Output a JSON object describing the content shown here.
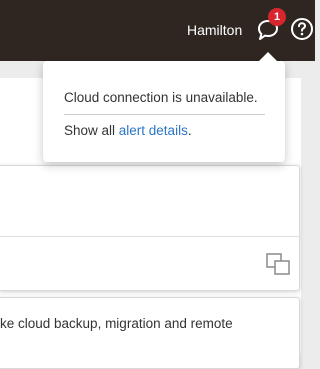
{
  "header": {
    "user_name": "Hamilton",
    "alerts_count": "1",
    "alerts_icon": "speech-bubble-icon",
    "help_icon": "question-circle-icon"
  },
  "alert_popover": {
    "message": "Cloud connection is unavailable.",
    "show_all_prefix": "Show all ",
    "link_text": "alert details",
    "suffix": "."
  },
  "cards": {
    "card_2_text": "ke cloud backup, migration and remote",
    "copy_icon": "copy-icon"
  },
  "colors": {
    "topbar": "#2f2622",
    "badge": "#d7262e",
    "link": "#2b76c6"
  }
}
